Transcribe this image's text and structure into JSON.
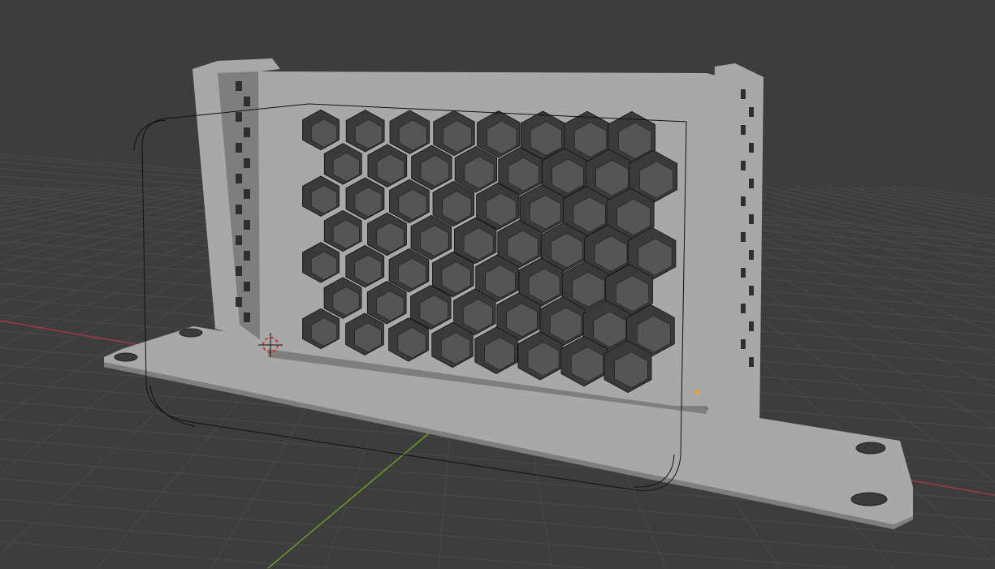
{
  "viewport": {
    "background": "#3d3d3d",
    "grid_color": "#4a4a4a",
    "x_axis_color": "#9c3a46",
    "y_axis_color": "#6a9a2a",
    "object_color": "#a8a8a8",
    "object_shadow": "#7e7e7e",
    "hole_color": "#3a3a3a",
    "wire_color": "#111111",
    "origin_color": "#f0a030"
  },
  "model": {
    "hex_rows": 7,
    "hex_cols": 8
  }
}
